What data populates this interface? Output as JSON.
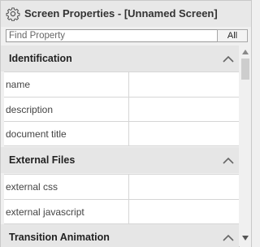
{
  "panel": {
    "title": "Screen Properties - [Unnamed Screen]",
    "icon": "gear-icon"
  },
  "search": {
    "placeholder": "Find Property",
    "value": "",
    "all_label": "All"
  },
  "sections": [
    {
      "label": "Identification",
      "rows": [
        {
          "name": "name",
          "value": ""
        },
        {
          "name": "description",
          "value": ""
        },
        {
          "name": "document title",
          "value": ""
        }
      ]
    },
    {
      "label": "External Files",
      "rows": [
        {
          "name": "external css",
          "value": ""
        },
        {
          "name": "external javascript",
          "value": ""
        }
      ]
    },
    {
      "label": "Transition Animation",
      "rows": []
    }
  ]
}
